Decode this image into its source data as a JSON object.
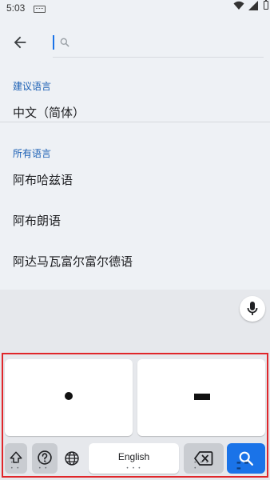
{
  "status_bar": {
    "time": "5:03",
    "icons": [
      "keyboard-notification-icon",
      "wifi-icon",
      "signal-icon",
      "battery-icon"
    ]
  },
  "search": {
    "value": "",
    "placeholder": "",
    "back_icon": "arrow-back-icon",
    "search_icon": "search-icon"
  },
  "suggested": {
    "label": "建议语言",
    "items": [
      {
        "label": "中文（简体）"
      }
    ]
  },
  "all_languages": {
    "label": "所有语言",
    "items": [
      {
        "label": "阿布哈兹语"
      },
      {
        "label": "阿布朗语"
      },
      {
        "label": "阿达马瓦富尔富尔德语"
      }
    ]
  },
  "keyboard": {
    "mode": "morse",
    "dot_key": "dot",
    "dash_key": "dash",
    "space_label": "English",
    "icons": {
      "mic": "mic-icon",
      "shift": "shift-icon",
      "help": "help-icon",
      "globe": "globe-icon",
      "backspace": "backspace-icon",
      "search": "search-icon"
    },
    "colors": {
      "accent": "#1a73e8",
      "highlight_frame": "#e0262a"
    }
  }
}
